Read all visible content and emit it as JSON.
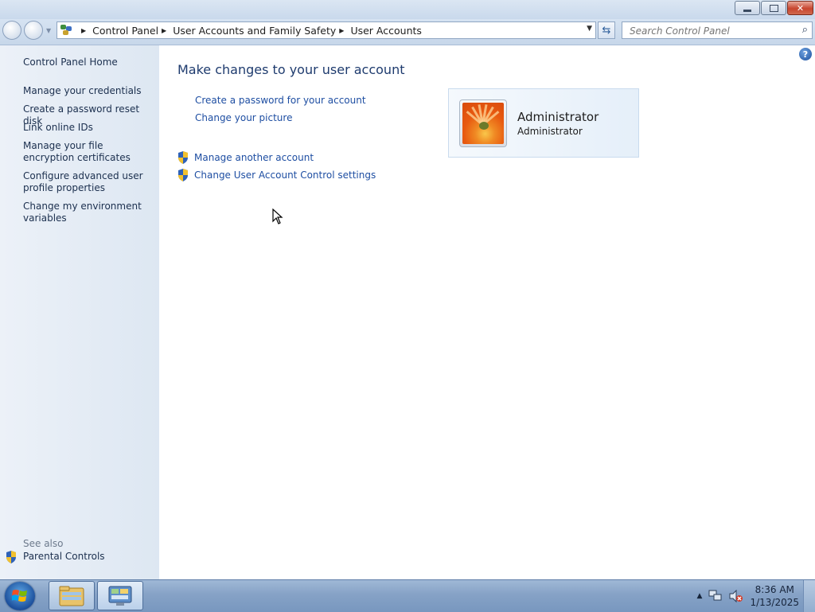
{
  "window": {
    "buttons": [
      "minimize",
      "maximize",
      "close"
    ]
  },
  "nav": {
    "breadcrumbs": [
      "Control Panel",
      "User Accounts and Family Safety",
      "User Accounts"
    ],
    "search_placeholder": "Search Control Panel"
  },
  "sidebar": {
    "home": "Control Panel Home",
    "items": [
      {
        "label": "Manage your credentials"
      },
      {
        "label": "Create a password reset disk"
      },
      {
        "label": "Link online IDs"
      },
      {
        "label": "Manage your file encryption certificates"
      },
      {
        "label": "Configure advanced user profile properties"
      },
      {
        "label": "Change my environment variables"
      }
    ],
    "see_also": "See also",
    "parental_controls": "Parental Controls"
  },
  "main": {
    "heading": "Make changes to your user account",
    "links": [
      "Create a password for your account",
      "Change your picture"
    ],
    "admin_links": [
      "Manage another account",
      "Change User Account Control settings"
    ],
    "account": {
      "name": "Administrator",
      "type": "Administrator"
    }
  },
  "taskbar": {
    "time": "8:36 AM",
    "date": "1/13/2025"
  },
  "icons": {
    "start": "windows-start-icon",
    "explorer": "folder-icon",
    "control_panel": "control-panel-icon",
    "help": "help-icon",
    "shield": "uac-shield-icon"
  },
  "colors": {
    "link": "#1e4ea2",
    "heading": "#1e3b6e",
    "sidebar_bg": "#e4ecf5",
    "taskbar": "#86a2c6"
  }
}
